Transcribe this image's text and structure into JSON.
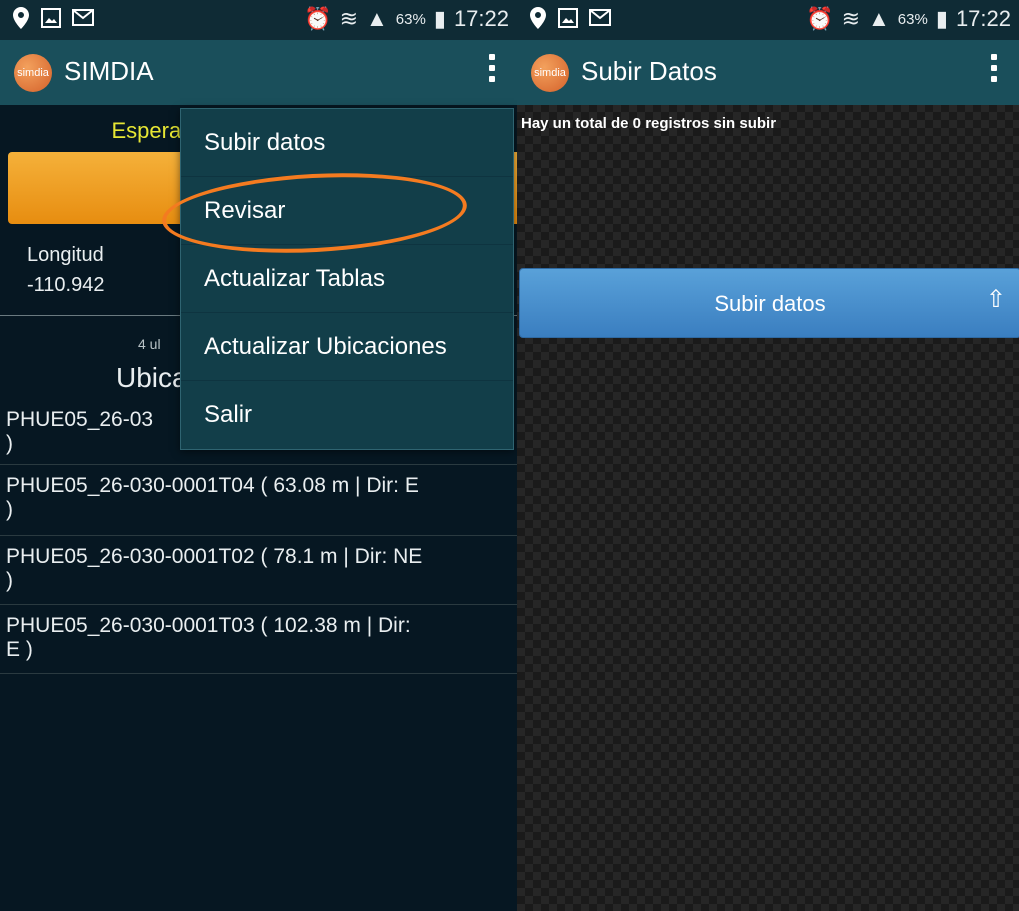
{
  "status_bar": {
    "battery": "63%",
    "time": "17:22",
    "icons": [
      "location-pin-icon",
      "gallery-icon",
      "mail-icon",
      "alarm-icon",
      "wifi-icon",
      "signal-icon",
      "battery-icon"
    ]
  },
  "left": {
    "app_title": "SIMDIA",
    "logo_text": "simdia",
    "status_text": "Esperar",
    "coords": {
      "label": "Longitud",
      "value": "-110.942"
    },
    "small_line": "4 ul",
    "section_title": "Ubica",
    "items": [
      "PHUE05_26-03",
      ")",
      "PHUE05_26-030-0001T04 ( 63.08 m | Dir: E",
      ")",
      "PHUE05_26-030-0001T02 ( 78.1 m | Dir: NE",
      ")",
      "PHUE05_26-030-0001T03 ( 102.38 m | Dir:",
      "E )"
    ],
    "menu": [
      "Subir datos",
      "Revisar",
      "Actualizar Tablas",
      "Actualizar Ubicaciones",
      "Salir"
    ]
  },
  "right": {
    "app_title": "Subir Datos",
    "logo_text": "simdia",
    "message": "Hay un total de 0 registros sin subir",
    "button_label": "Subir datos"
  },
  "colors": {
    "status_bar": "#0f2b35",
    "app_bar": "#1a4f5b",
    "status_text": "#e6e634",
    "highlight": "#f47b20",
    "upload_button": "#4a90d0"
  }
}
